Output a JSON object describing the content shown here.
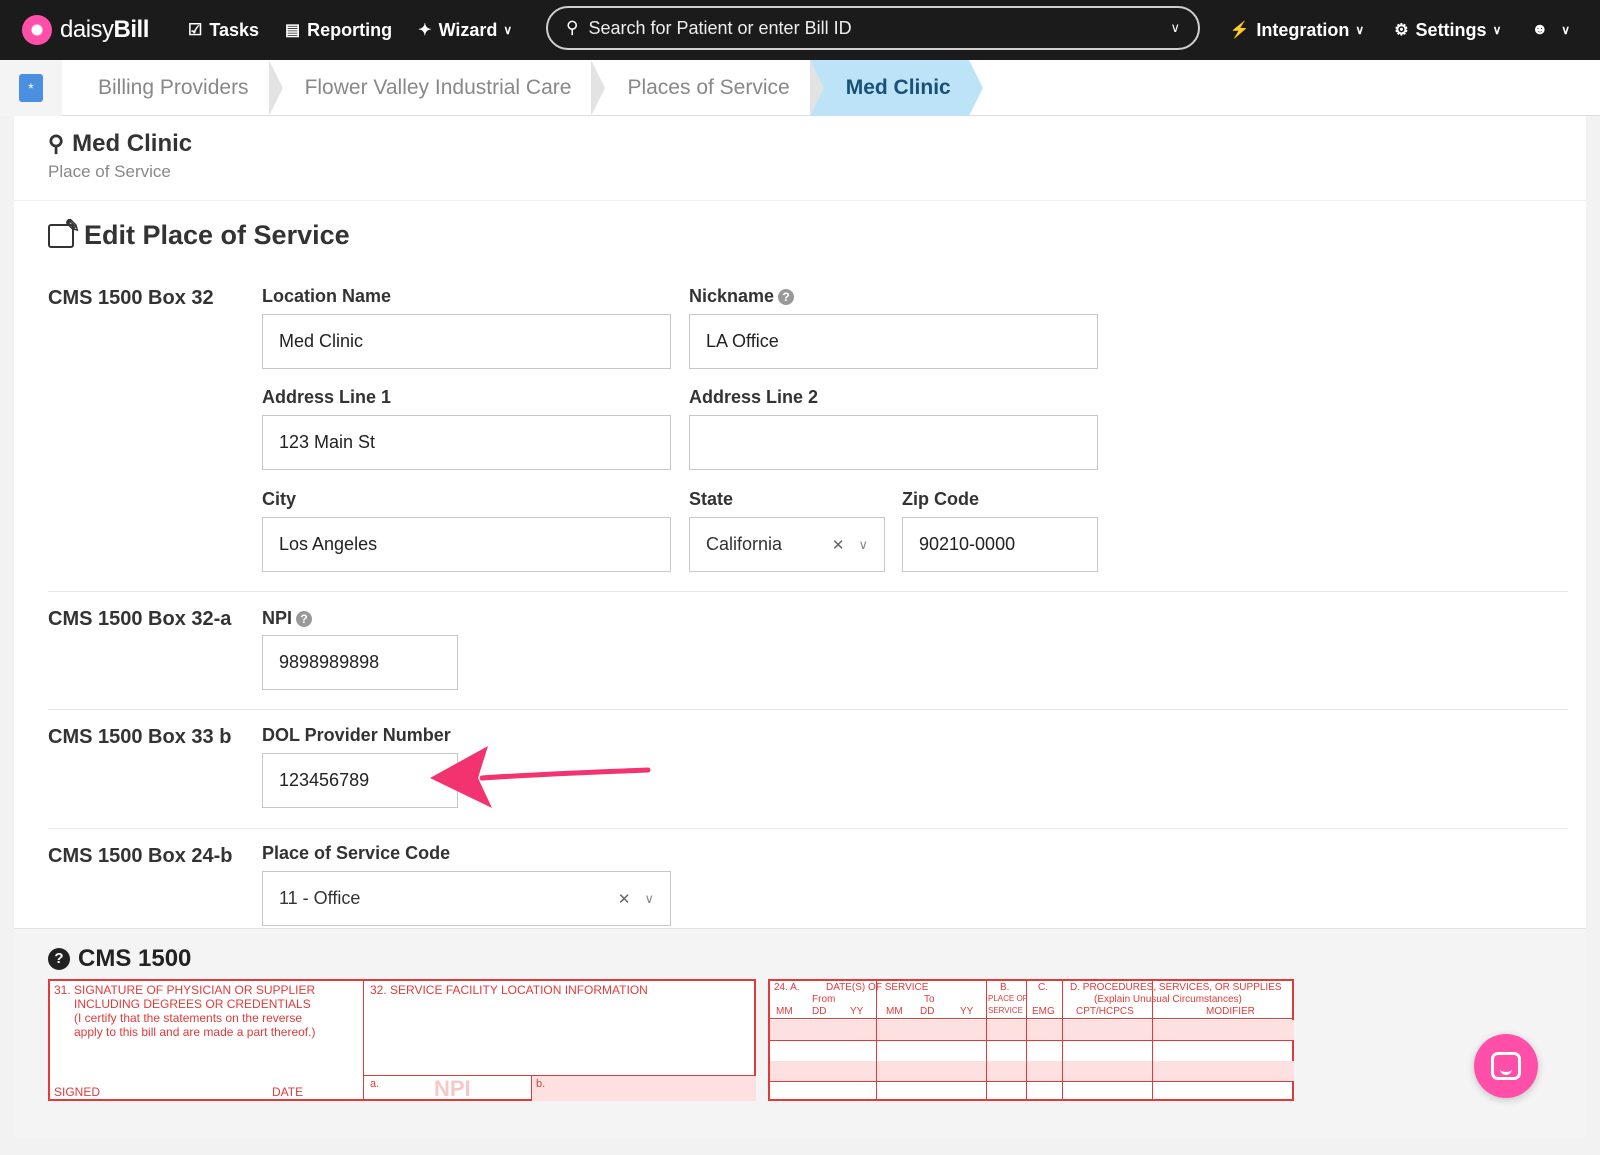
{
  "nav": {
    "brand_light": "daisy",
    "brand_bold": "Bill",
    "tasks": "Tasks",
    "reporting": "Reporting",
    "wizard": "Wizard",
    "search_placeholder": "Search for Patient or enter Bill ID",
    "integration": "Integration",
    "settings": "Settings",
    "icons": [
      "daisy-logo-icon",
      "clipboard-icon",
      "bar-chart-icon",
      "magic-wand-icon",
      "search-icon",
      "bolt-icon",
      "gear-icon",
      "user-circle-icon"
    ]
  },
  "breadcrumb": {
    "items": [
      "Billing Providers",
      "Flower Valley Industrial Care",
      "Places of Service",
      "Med Clinic"
    ]
  },
  "page": {
    "title": "Med Clinic",
    "subtitle": "Place of Service",
    "edit_title": "Edit Place of Service"
  },
  "form": {
    "sections": {
      "box32": "CMS 1500 Box 32",
      "box32a": "CMS 1500 Box 32-a",
      "box33b": "CMS 1500 Box 33 b",
      "box24b": "CMS 1500 Box 24-b"
    },
    "location_name": {
      "label": "Location Name",
      "value": "Med Clinic"
    },
    "nickname": {
      "label": "Nickname",
      "value": "LA Office"
    },
    "address1": {
      "label": "Address Line 1",
      "value": "123 Main St"
    },
    "address2": {
      "label": "Address Line 2",
      "value": ""
    },
    "city": {
      "label": "City",
      "value": "Los Angeles"
    },
    "state": {
      "label": "State",
      "value": "California"
    },
    "zip": {
      "label": "Zip Code",
      "value": "90210-0000"
    },
    "npi": {
      "label": "NPI",
      "value": "9898989898"
    },
    "dol": {
      "label": "DOL Provider Number",
      "value": "123456789"
    },
    "pos_code": {
      "label": "Place of Service Code",
      "value": "11 - Office"
    }
  },
  "cms": {
    "title": "CMS 1500",
    "box31_lines": [
      "31. SIGNATURE OF PHYSICIAN OR SUPPLIER",
      "INCLUDING DEGREES OR CREDENTIALS",
      "(I certify that the statements on the reverse",
      "apply to this bill and are made a part thereof.)"
    ],
    "signed": "SIGNED",
    "date": "DATE",
    "box32": "32. SERVICE FACILITY LOCATION INFORMATION",
    "box32a": "a.",
    "npi_watermark": "NPI",
    "box32b": "b.",
    "box24": {
      "a": "24. A.",
      "dates": "DATE(S) OF SERVICE",
      "from": "From",
      "to": "To",
      "mm1": "MM",
      "dd1": "DD",
      "yy1": "YY",
      "mm2": "MM",
      "dd2": "DD",
      "yy2": "YY",
      "b": "B.",
      "place_of": "PLACE OF",
      "service": "SERVICE",
      "c": "C.",
      "emg": "EMG",
      "d": "D. PROCEDURES, SERVICES, OR SUPPLIES",
      "explain": "(Explain Unusual Circumstances)",
      "cpt": "CPT/HCPCS",
      "modifier": "MODIFIER"
    }
  },
  "colors": {
    "brand_pink": "#ff4fa8",
    "nav_bg": "#1b1b1b",
    "crumb_active": "#bde3f9",
    "form_red": "#e23a3a",
    "arrow": "#f2336f"
  }
}
